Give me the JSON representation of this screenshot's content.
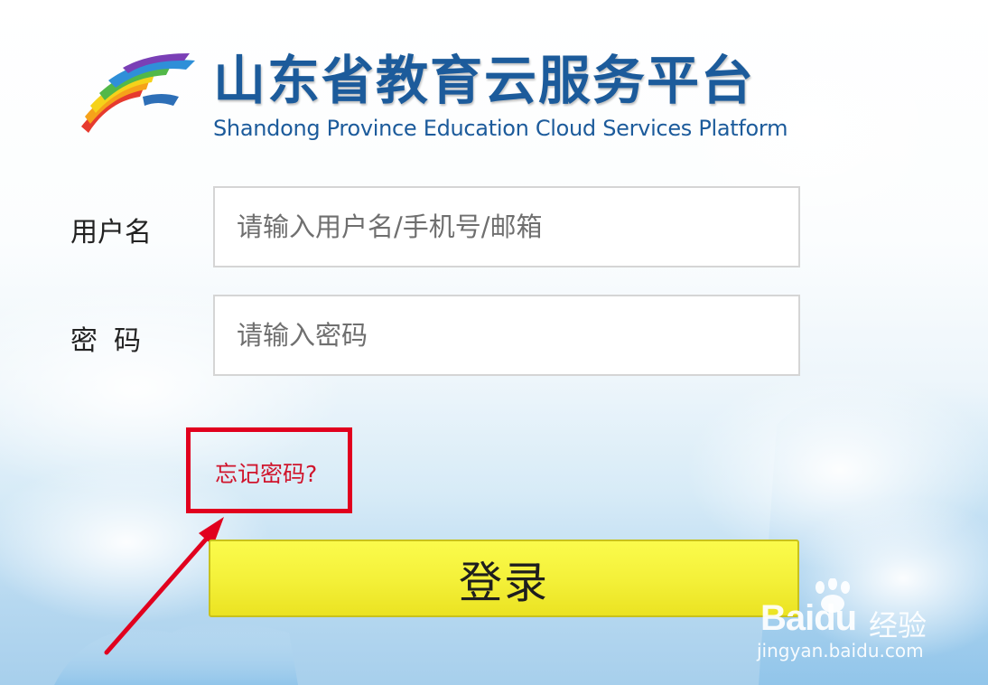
{
  "header": {
    "title_cn": "山东省教育云服务平台",
    "title_en": "Shandong Province Education Cloud Services Platform",
    "brand_color": "#1c5b9b"
  },
  "form": {
    "username_label": "用户名",
    "username_placeholder": "请输入用户名/手机号/邮箱",
    "password_label": "密码",
    "password_placeholder": "请输入密码",
    "forgot_link": "忘记密码?",
    "login_button": "登录",
    "button_color": "#f4f13a",
    "highlight_color": "#e1001e"
  },
  "watermark": {
    "brand_left": "Bai",
    "brand_right": "du",
    "brand_cn": "经验",
    "url": "jingyan.baidu.com"
  }
}
